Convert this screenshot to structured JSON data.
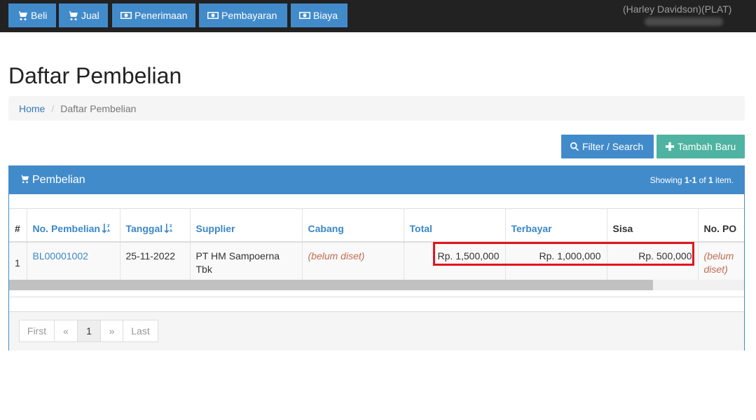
{
  "navbar": {
    "buttons": [
      {
        "label": "Beli",
        "icon": "cart-icon"
      },
      {
        "label": "Jual",
        "icon": "cart-icon"
      },
      {
        "label": "Penerimaan",
        "icon": "money-icon"
      },
      {
        "label": "Pembayaran",
        "icon": "money-icon"
      },
      {
        "label": "Biaya",
        "icon": "money-icon"
      }
    ],
    "user_name": "(Harley Davidson)(PLAT)"
  },
  "page_title": "Daftar Pembelian",
  "breadcrumb": {
    "home": "Home",
    "current": "Daftar Pembelian"
  },
  "toolbar": {
    "filter_label": "Filter / Search",
    "add_label": "Tambah Baru"
  },
  "panel": {
    "title": "Pembelian",
    "summary": {
      "prefix": "Showing ",
      "range": "1-1",
      "of": " of ",
      "total": "1",
      "suffix": " item."
    }
  },
  "table": {
    "columns": [
      "#",
      "No. Pembelian",
      "Tanggal",
      "Supplier",
      "Cabang",
      "Total",
      "Terbayar",
      "Sisa",
      "No. PO"
    ],
    "rows": [
      {
        "index": "1",
        "no_pembelian": "BL00001002",
        "tanggal": "25-11-2022",
        "supplier": "PT HM Sampoerna Tbk",
        "cabang": "(belum diset)",
        "total": "Rp. 1,500,000",
        "terbayar": "Rp. 1,000,000",
        "sisa": "Rp. 500,000",
        "no_po": "(belum diset)"
      }
    ]
  },
  "pagination": {
    "first": "First",
    "prev": "«",
    "current": "1",
    "next": "»",
    "last": "Last"
  },
  "colors": {
    "primary": "#428bca",
    "success": "#4eb3a0",
    "navbar": "#222222",
    "unset_text": "#c26a53",
    "highlight": "#e0161b"
  }
}
